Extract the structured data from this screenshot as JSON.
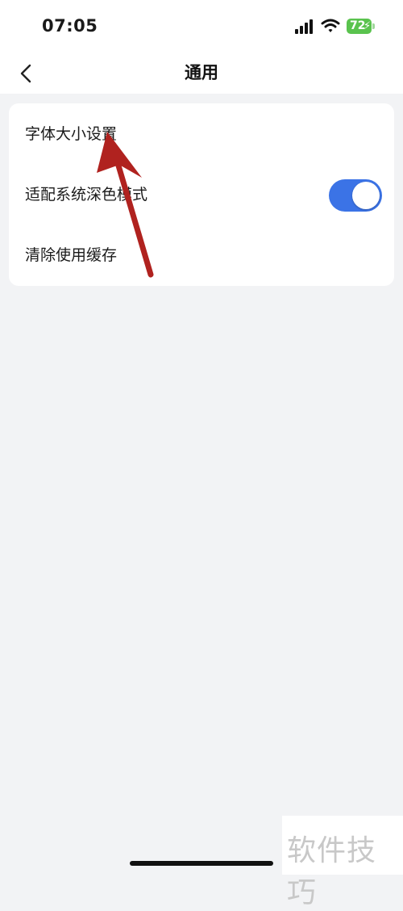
{
  "status_bar": {
    "time": "07:05",
    "battery_level": "72",
    "battery_color": "#5ac34e",
    "icons": [
      "signal-icon",
      "wifi-icon",
      "battery-icon",
      "charging-bolt-icon"
    ]
  },
  "nav": {
    "title": "通用",
    "back_icon": "chevron-left-icon"
  },
  "settings": {
    "items": [
      {
        "label": "字体大小设置"
      },
      {
        "label": "适配系统深色模式",
        "toggle_on": true
      },
      {
        "label": "清除使用缓存"
      }
    ]
  },
  "annotation": {
    "arrow_color": "#b0221f"
  },
  "watermark": {
    "text": "软件技巧"
  },
  "colors": {
    "accent": "#3b73e6",
    "background": "#f2f3f5",
    "card": "#ffffff"
  }
}
